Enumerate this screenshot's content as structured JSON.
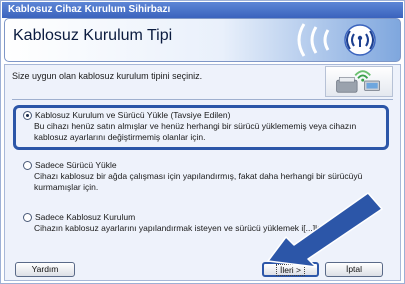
{
  "window": {
    "title": "Kablosuz Cihaz Kurulum Sihirbazı"
  },
  "header": {
    "title": "Kablosuz Kurulum Tipi",
    "icon": "wifi-signal-icon"
  },
  "dialog": {
    "instruction": "Size uygun olan kablosuz kurulum tipini seçiniz.",
    "options": [
      {
        "label": "Kablosuz Kurulum ve Sürücü Yükle (Tavsiye Edilen)",
        "description_lines": [
          "Bu cihazı henüz satın almışlar ve henüz herhangi bir sürücü yüklememiş veya cihazın",
          "kablosuz ayarlarını değiştirmemiş olanlar için."
        ],
        "selected": true
      },
      {
        "label": "Sadece Sürücü Yükle",
        "description_lines": [
          "Cihazı kablosuz bir ağda çalışması için yapılandırmış, fakat daha herhangi bir sürücüyü",
          "kurmamışlar için."
        ],
        "selected": false
      },
      {
        "label": "Sadece Kablosuz Kurulum",
        "description_lines": [
          "Cihazın kablosuz ayarlarını yapılandırmak isteyen ve sürücü yüklemek i[...]ler için."
        ],
        "selected": false
      }
    ]
  },
  "buttons": {
    "help": "Yardım",
    "next": "İleri >",
    "cancel": "İptal"
  },
  "colors": {
    "highlight": "#2c56a8",
    "title_bar": "#3a63bd",
    "arrow": "#2c56a8"
  }
}
